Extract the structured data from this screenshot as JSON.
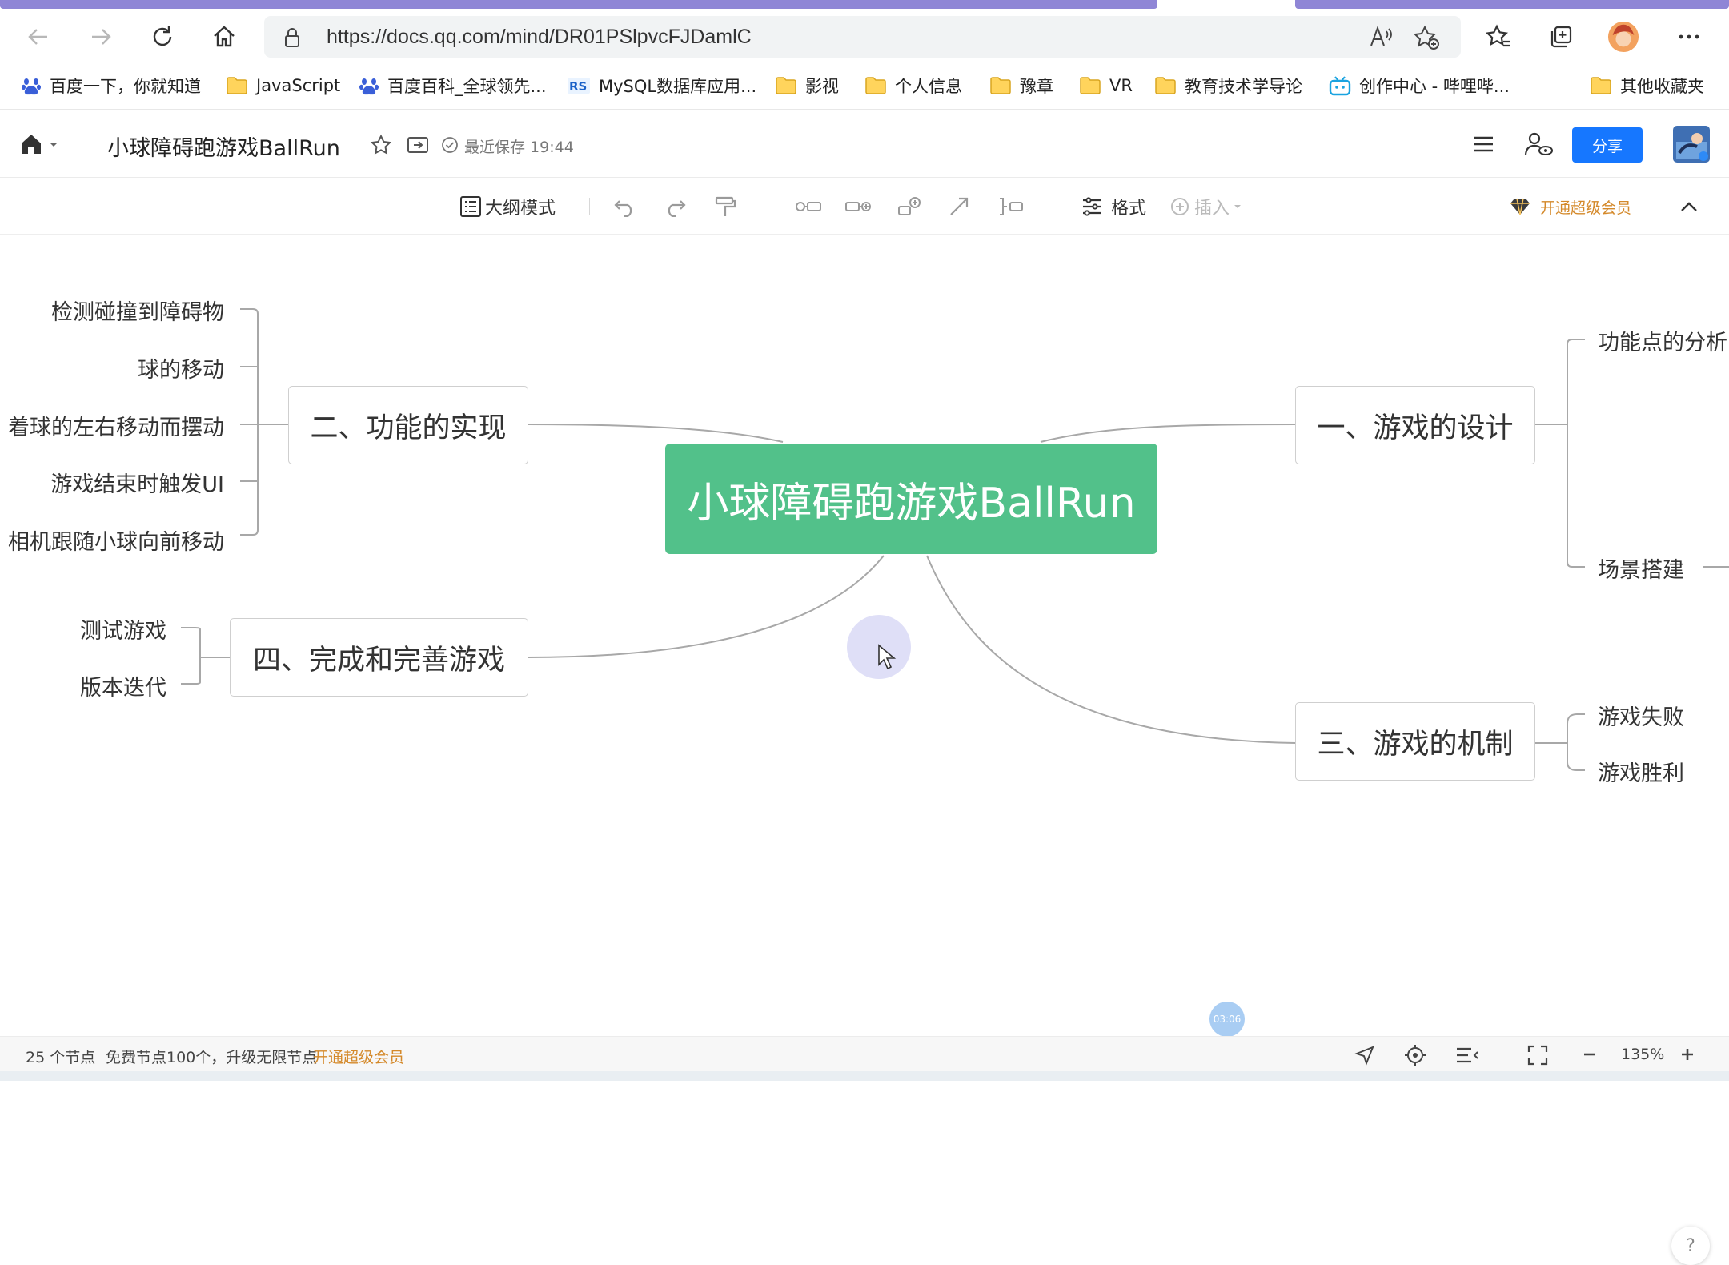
{
  "browser": {
    "url": "https://docs.qq.com/mind/DR01PSlpvcFJDamlC",
    "bookmarks": [
      {
        "label": "百度一下，你就知道",
        "icon": "baidu-paw-icon"
      },
      {
        "label": "JavaScript",
        "icon": "folder-icon"
      },
      {
        "label": "百度百科_全球领先...",
        "icon": "baidu-paw-icon"
      },
      {
        "label": "MySQL数据库应用...",
        "icon": "site-logo-icon"
      },
      {
        "label": "影视",
        "icon": "folder-icon"
      },
      {
        "label": "个人信息",
        "icon": "folder-icon"
      },
      {
        "label": "豫章",
        "icon": "folder-icon"
      },
      {
        "label": "VR",
        "icon": "folder-icon"
      },
      {
        "label": "教育技术学导论",
        "icon": "folder-icon"
      },
      {
        "label": "创作中心 - 哔哩哔...",
        "icon": "bilibili-icon"
      },
      {
        "label": "其他收藏夹",
        "icon": "folder-icon"
      }
    ]
  },
  "app": {
    "doc_title": "小球障碍跑游戏BallRun",
    "save_status": "最近保存 19:44",
    "share_label": "分享"
  },
  "toolbar": {
    "outline_label": "大纲模式",
    "format_label": "格式",
    "insert_label": "插入",
    "vip_label": "开通超级会员"
  },
  "mindmap": {
    "root": "小球障碍跑游戏BallRun",
    "branch_1": "一、游戏的设计",
    "branch_2": "二、功能的实现",
    "branch_3": "三、游戏的机制",
    "branch_4": "四、完成和完善游戏",
    "b1_children": [
      "功能点的分析",
      "场景搭建"
    ],
    "b2_children": [
      "检测碰撞到障碍物",
      "球的移动",
      "着球的左右移动而摆动",
      "游戏结束时触发UI",
      "相机跟随小球向前移动"
    ],
    "b3_children": [
      "游戏失败",
      "游戏胜利"
    ],
    "b4_children": [
      "测试游戏",
      "版本迭代"
    ]
  },
  "timer_badge": "03:06",
  "status": {
    "node_count": "25 个节点",
    "free_limit": "免费节点100个，升级无限节点",
    "vip_link": "开通超级会员",
    "zoom": "135%"
  },
  "colors": {
    "accent_blue": "#1677ff",
    "root_green": "#52c18a",
    "vip_orange": "#d4892a"
  }
}
